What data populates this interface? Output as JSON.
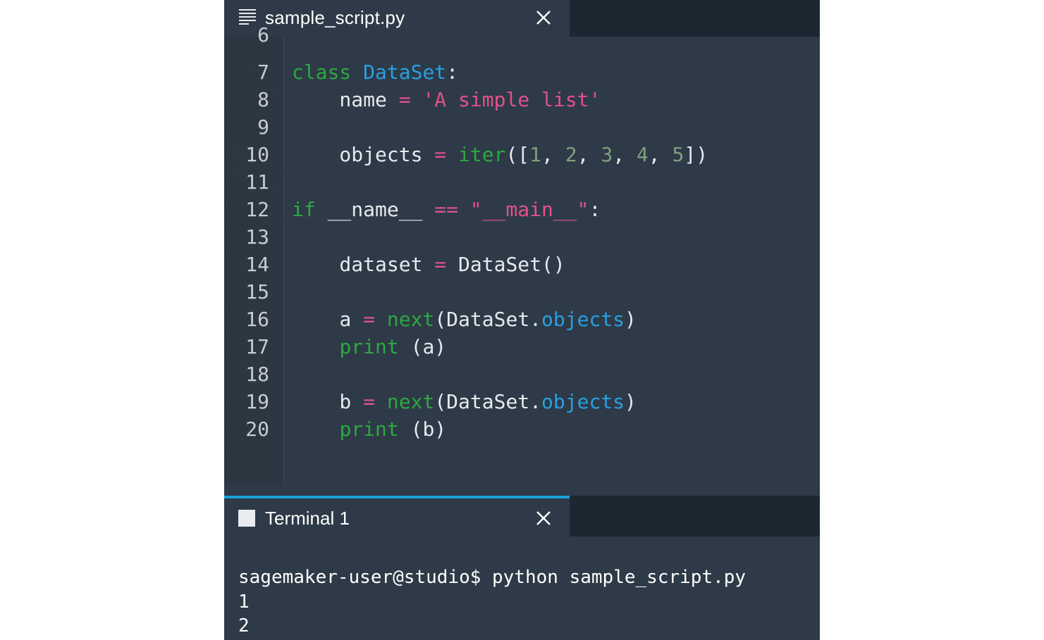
{
  "editor": {
    "tab_label": "sample_script.py",
    "tab_icon": "file-text-icon",
    "close_icon": "close-icon",
    "partial_top_line_number": "6",
    "lines": [
      {
        "num": "7",
        "tokens": [
          [
            "kw",
            "class"
          ],
          [
            "txt",
            " "
          ],
          [
            "cls",
            "DataSet"
          ],
          [
            "txt",
            ":"
          ]
        ]
      },
      {
        "num": "8",
        "tokens": [
          [
            "txt",
            "    name "
          ],
          [
            "op",
            "="
          ],
          [
            "txt",
            " "
          ],
          [
            "str",
            "'A simple list'"
          ]
        ]
      },
      {
        "num": "9",
        "tokens": []
      },
      {
        "num": "10",
        "tokens": [
          [
            "txt",
            "    objects "
          ],
          [
            "op",
            "="
          ],
          [
            "txt",
            " "
          ],
          [
            "fn",
            "iter"
          ],
          [
            "txt",
            "(["
          ],
          [
            "num",
            "1"
          ],
          [
            "txt",
            ", "
          ],
          [
            "num",
            "2"
          ],
          [
            "txt",
            ", "
          ],
          [
            "num",
            "3"
          ],
          [
            "txt",
            ", "
          ],
          [
            "num",
            "4"
          ],
          [
            "txt",
            ", "
          ],
          [
            "num",
            "5"
          ],
          [
            "txt",
            "])"
          ]
        ]
      },
      {
        "num": "11",
        "tokens": []
      },
      {
        "num": "12",
        "tokens": [
          [
            "kw",
            "if"
          ],
          [
            "txt",
            " __name__ "
          ],
          [
            "op",
            "=="
          ],
          [
            "txt",
            " "
          ],
          [
            "str",
            "\"__main__\""
          ],
          [
            "txt",
            ":"
          ]
        ]
      },
      {
        "num": "13",
        "tokens": []
      },
      {
        "num": "14",
        "tokens": [
          [
            "txt",
            "    dataset "
          ],
          [
            "op",
            "="
          ],
          [
            "txt",
            " DataSet()"
          ]
        ]
      },
      {
        "num": "15",
        "tokens": []
      },
      {
        "num": "16",
        "tokens": [
          [
            "txt",
            "    a "
          ],
          [
            "op",
            "="
          ],
          [
            "txt",
            " "
          ],
          [
            "fn",
            "next"
          ],
          [
            "txt",
            "(DataSet."
          ],
          [
            "attr",
            "objects"
          ],
          [
            "txt",
            ")"
          ]
        ]
      },
      {
        "num": "17",
        "tokens": [
          [
            "txt",
            "    "
          ],
          [
            "fn",
            "print"
          ],
          [
            "txt",
            " (a)"
          ]
        ]
      },
      {
        "num": "18",
        "tokens": []
      },
      {
        "num": "19",
        "tokens": [
          [
            "txt",
            "    b "
          ],
          [
            "op",
            "="
          ],
          [
            "txt",
            " "
          ],
          [
            "fn",
            "next"
          ],
          [
            "txt",
            "(DataSet."
          ],
          [
            "attr",
            "objects"
          ],
          [
            "txt",
            ")"
          ]
        ]
      },
      {
        "num": "20",
        "tokens": [
          [
            "txt",
            "    "
          ],
          [
            "fn",
            "print"
          ],
          [
            "txt",
            " (b)"
          ]
        ]
      }
    ]
  },
  "terminal": {
    "tab_label": "Terminal 1",
    "tab_icon": "terminal-icon",
    "close_icon": "close-icon",
    "accent_color": "#1a9fd9",
    "output_lines": [
      "sagemaker-user@studio$ python sample_script.py",
      "1",
      "2"
    ]
  },
  "colors": {
    "keyword": "#2ca83f",
    "class_name": "#2a9fe0",
    "operator": "#e0528a",
    "string": "#e0528a",
    "number": "#7fa07f",
    "background": "#2e3a47"
  }
}
